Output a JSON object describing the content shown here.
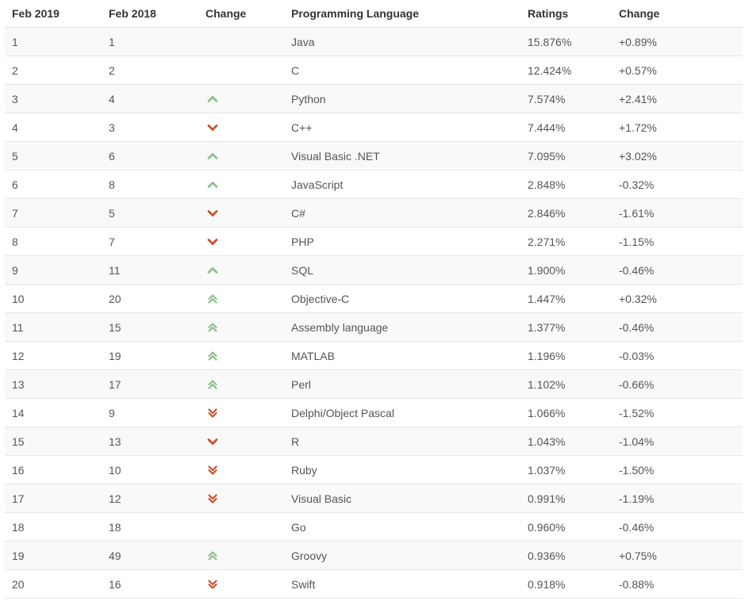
{
  "table": {
    "headers": {
      "rank_current": "Feb 2019",
      "rank_previous": "Feb 2018",
      "change": "Change",
      "language": "Programming Language",
      "ratings": "Ratings",
      "rating_change": "Change"
    },
    "rows": [
      {
        "rank": "1",
        "prev": "1",
        "trend": "none",
        "language": "Java",
        "rating": "15.876%",
        "delta": "+0.89%"
      },
      {
        "rank": "2",
        "prev": "2",
        "trend": "none",
        "language": "C",
        "rating": "12.424%",
        "delta": "+0.57%"
      },
      {
        "rank": "3",
        "prev": "4",
        "trend": "up",
        "language": "Python",
        "rating": "7.574%",
        "delta": "+2.41%"
      },
      {
        "rank": "4",
        "prev": "3",
        "trend": "down",
        "language": "C++",
        "rating": "7.444%",
        "delta": "+1.72%"
      },
      {
        "rank": "5",
        "prev": "6",
        "trend": "up",
        "language": "Visual Basic .NET",
        "rating": "7.095%",
        "delta": "+3.02%"
      },
      {
        "rank": "6",
        "prev": "8",
        "trend": "up",
        "language": "JavaScript",
        "rating": "2.848%",
        "delta": "-0.32%"
      },
      {
        "rank": "7",
        "prev": "5",
        "trend": "down",
        "language": "C#",
        "rating": "2.846%",
        "delta": "-1.61%"
      },
      {
        "rank": "8",
        "prev": "7",
        "trend": "down",
        "language": "PHP",
        "rating": "2.271%",
        "delta": "-1.15%"
      },
      {
        "rank": "9",
        "prev": "11",
        "trend": "up",
        "language": "SQL",
        "rating": "1.900%",
        "delta": "-0.46%"
      },
      {
        "rank": "10",
        "prev": "20",
        "trend": "up-double",
        "language": "Objective-C",
        "rating": "1.447%",
        "delta": "+0.32%"
      },
      {
        "rank": "11",
        "prev": "15",
        "trend": "up-double",
        "language": "Assembly language",
        "rating": "1.377%",
        "delta": "-0.46%"
      },
      {
        "rank": "12",
        "prev": "19",
        "trend": "up-double",
        "language": "MATLAB",
        "rating": "1.196%",
        "delta": "-0.03%"
      },
      {
        "rank": "13",
        "prev": "17",
        "trend": "up-double",
        "language": "Perl",
        "rating": "1.102%",
        "delta": "-0.66%"
      },
      {
        "rank": "14",
        "prev": "9",
        "trend": "down-double",
        "language": "Delphi/Object Pascal",
        "rating": "1.066%",
        "delta": "-1.52%"
      },
      {
        "rank": "15",
        "prev": "13",
        "trend": "down",
        "language": "R",
        "rating": "1.043%",
        "delta": "-1.04%"
      },
      {
        "rank": "16",
        "prev": "10",
        "trend": "down-double",
        "language": "Ruby",
        "rating": "1.037%",
        "delta": "-1.50%"
      },
      {
        "rank": "17",
        "prev": "12",
        "trend": "down-double",
        "language": "Visual Basic",
        "rating": "0.991%",
        "delta": "-1.19%"
      },
      {
        "rank": "18",
        "prev": "18",
        "trend": "none",
        "language": "Go",
        "rating": "0.960%",
        "delta": "-0.46%"
      },
      {
        "rank": "19",
        "prev": "49",
        "trend": "up-double",
        "language": "Groovy",
        "rating": "0.936%",
        "delta": "+0.75%"
      },
      {
        "rank": "20",
        "prev": "16",
        "trend": "down-double",
        "language": "Swift",
        "rating": "0.918%",
        "delta": "-0.88%"
      }
    ]
  },
  "icons": {
    "up": "chevron-up-icon",
    "up-double": "double-chevron-up-icon",
    "down": "chevron-down-icon",
    "down-double": "double-chevron-down-icon"
  },
  "colors": {
    "trend_up": "#8cc08c",
    "trend_down": "#c8522c",
    "row_alt": "#f9f9f9",
    "row_border": "#e5e5e5"
  }
}
